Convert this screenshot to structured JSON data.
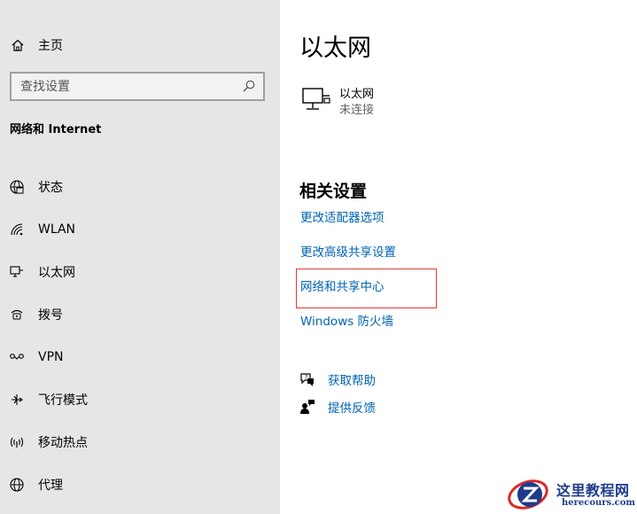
{
  "sidebar": {
    "home_label": "主页",
    "search_placeholder": "查找设置",
    "section_title": "网络和 Internet",
    "items": [
      {
        "label": "状态",
        "icon": "globe-icon"
      },
      {
        "label": "WLAN",
        "icon": "wifi-icon"
      },
      {
        "label": "以太网",
        "icon": "ethernet-icon"
      },
      {
        "label": "拨号",
        "icon": "dialup-icon"
      },
      {
        "label": "VPN",
        "icon": "vpn-icon"
      },
      {
        "label": "飞行模式",
        "icon": "airplane-icon"
      },
      {
        "label": "移动热点",
        "icon": "hotspot-icon"
      },
      {
        "label": "代理",
        "icon": "proxy-globe-icon"
      }
    ]
  },
  "main": {
    "title": "以太网",
    "adapter": {
      "name": "以太网",
      "status": "未连接"
    },
    "related_title": "相关设置",
    "links": [
      "更改适配器选项",
      "更改高级共享设置",
      "网络和共享中心",
      "Windows 防火墙"
    ],
    "help": [
      {
        "label": "获取帮助",
        "icon": "help-chat-icon"
      },
      {
        "label": "提供反馈",
        "icon": "feedback-icon"
      }
    ]
  },
  "watermark": {
    "title": "这里教程网",
    "url": "herecours.com"
  },
  "colors": {
    "sidebar_bg": "#e6e6e6",
    "link": "#0063b1",
    "highlight": "#e03a3a"
  }
}
